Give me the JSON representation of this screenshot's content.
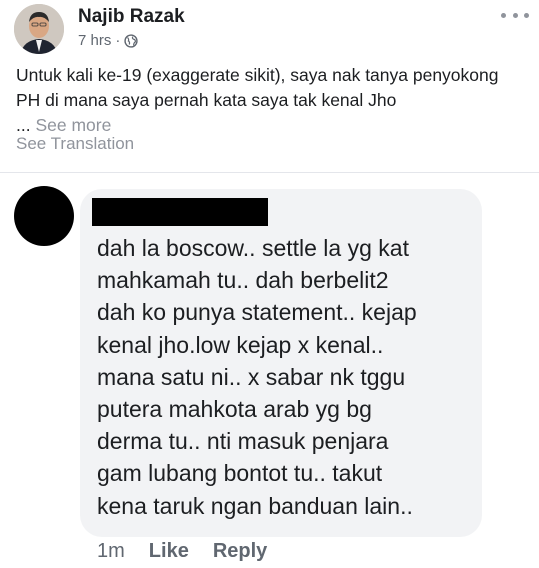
{
  "post": {
    "author": "Najib Razak",
    "time": "7 hrs",
    "separator": "·",
    "text": "Untuk kali ke-19 (exaggerate sikit), saya nak tanya penyokong PH di mana saya pernah kata saya tak kenal Jho",
    "ellipsis": "...",
    "see_more": "See more",
    "see_translation": "See Translation"
  },
  "comment": {
    "text": "dah la boscow.. settle la yg kat\nmahkamah tu.. dah berbelit2\ndah ko punya statement.. kejap\nkenal jho.low kejap x kenal..\nmana satu ni.. x sabar nk tggu\nputera mahkota arab yg bg\nderma tu.. nti masuk penjara\ngam lubang bontot tu.. takut\nkena taruk ngan banduan lain..",
    "time": "1m",
    "like_label": "Like",
    "reply_label": "Reply"
  },
  "icons": {
    "privacy": "globe-icon",
    "menu": "more-options-icon"
  },
  "colors": {
    "text_primary": "#1c1e21",
    "text_secondary": "#606770",
    "bubble": "#f2f3f5"
  }
}
